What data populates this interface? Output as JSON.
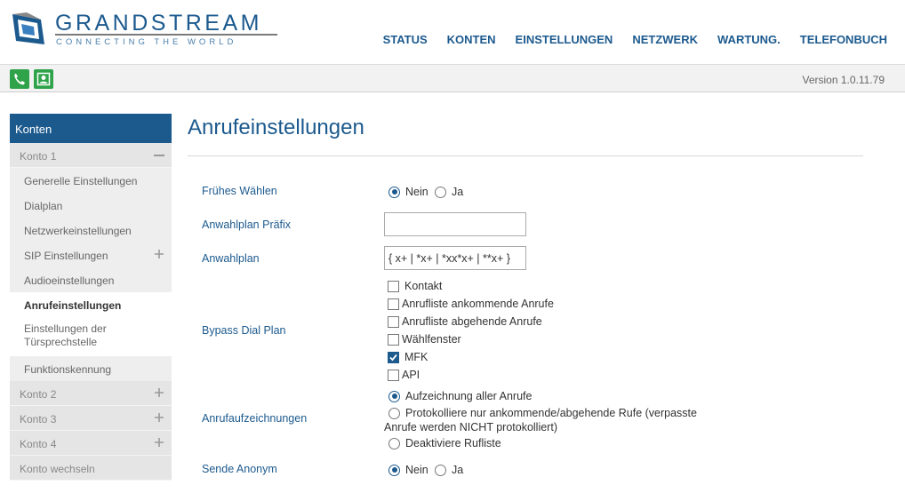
{
  "brand": {
    "name": "GRANDSTREAM",
    "tagline": "CONNECTING THE WORLD"
  },
  "nav": [
    "STATUS",
    "KONTEN",
    "EINSTELLUNGEN",
    "NETZWERK",
    "WARTUNG.",
    "TELEFONBUCH"
  ],
  "toolbar": {
    "version": "Version 1.0.11.79",
    "icons": [
      "phone-icon",
      "contact-icon"
    ]
  },
  "sidebar": {
    "title": "Konten",
    "items": [
      {
        "label": "Konto 1",
        "kind": "group",
        "symbol": "minus"
      },
      {
        "label": "Generelle Einstellungen",
        "kind": "sub"
      },
      {
        "label": "Dialplan",
        "kind": "sub"
      },
      {
        "label": "Netzwerkeinstellungen",
        "kind": "sub"
      },
      {
        "label": "SIP Einstellungen",
        "kind": "sub",
        "symbol": "plus"
      },
      {
        "label": "Audioeinstellungen",
        "kind": "sub"
      },
      {
        "label": "Anrufeinstellungen",
        "kind": "sub",
        "active": true
      },
      {
        "label": "Einstellungen der Türsprechstelle",
        "kind": "sub"
      },
      {
        "label": "Funktionskennung",
        "kind": "sub"
      },
      {
        "label": "Konto 2",
        "kind": "group",
        "symbol": "plus"
      },
      {
        "label": "Konto 3",
        "kind": "group",
        "symbol": "plus"
      },
      {
        "label": "Konto 4",
        "kind": "group",
        "symbol": "plus"
      },
      {
        "label": "Konto wechseln",
        "kind": "group"
      }
    ]
  },
  "main": {
    "title": "Anrufeinstellungen",
    "fruehes_waehlen": {
      "label": "Frühes Wählen",
      "options": [
        "Nein",
        "Ja"
      ],
      "selected": "Nein"
    },
    "anwahlplan_praefix": {
      "label": "Anwahlplan Präfix",
      "value": ""
    },
    "anwahlplan": {
      "label": "Anwahlplan",
      "value": "{ x+ | *x+ | *xx*x+ | **x+ }"
    },
    "bypass_dial_plan": {
      "label": "Bypass Dial Plan",
      "options": [
        {
          "label": "Kontakt",
          "checked": false
        },
        {
          "label": "Anrufliste ankommende Anrufe",
          "checked": false
        },
        {
          "label": "Anrufliste abgehende Anrufe",
          "checked": false
        },
        {
          "label": "Wählfenster",
          "checked": false
        },
        {
          "label": "MFK",
          "checked": true
        },
        {
          "label": "API",
          "checked": false
        }
      ]
    },
    "anrufaufzeichnungen": {
      "label": "Anrufaufzeichnungen",
      "options": [
        "Aufzeichnung aller Anrufe",
        "Protokolliere nur ankommende/abgehende Rufe (verpasste",
        "Anrufe werden NICHT protokolliert)",
        "Deaktiviere Rufliste"
      ],
      "selected": "Aufzeichnung aller Anrufe"
    },
    "sende_anonym": {
      "label": "Sende Anonym",
      "options": [
        "Nein",
        "Ja"
      ],
      "selected": "Nein"
    }
  },
  "colors": {
    "brand_blue": "#1c5a8e",
    "green": "#2fa34a",
    "sidebar_bg": "#eeeeee"
  }
}
